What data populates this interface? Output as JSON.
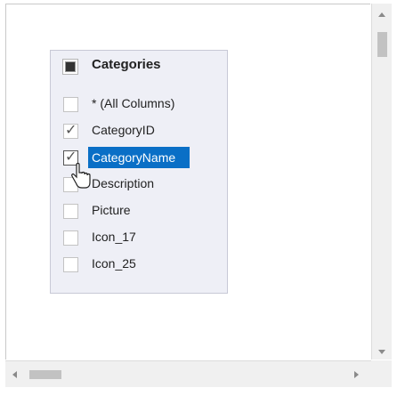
{
  "table": {
    "title": "Categories",
    "rows": [
      {
        "label": "* (All Columns)",
        "checked": false
      },
      {
        "label": "CategoryID",
        "checked": true
      },
      {
        "label": "CategoryName",
        "checked": true,
        "selected": true
      },
      {
        "label": "Description",
        "checked": false
      },
      {
        "label": "Picture",
        "checked": false
      },
      {
        "label": "Icon_17",
        "checked": false
      },
      {
        "label": "Icon_25",
        "checked": false
      }
    ]
  },
  "colors": {
    "selection": "#0a6fc6",
    "card_background": "#eeeff6"
  },
  "icons": {
    "table": "table-icon",
    "check": "check-icon",
    "cursor": "hand-cursor-icon"
  },
  "check_glyph": "✓"
}
